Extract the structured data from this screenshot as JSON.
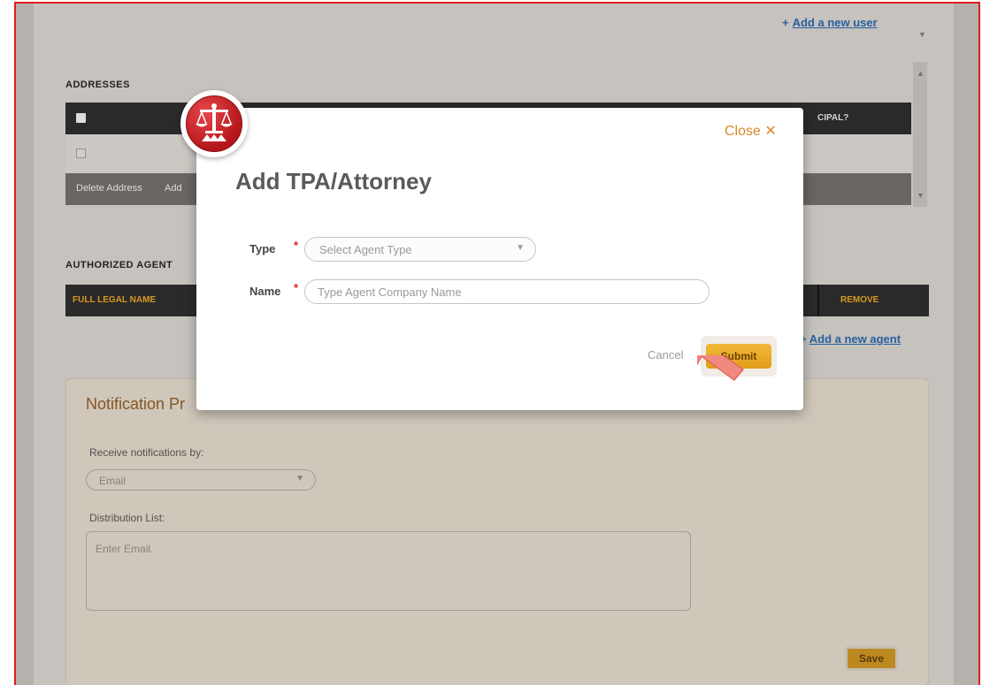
{
  "header": {
    "add_user_plus": "+",
    "add_user_label": "Add a new user"
  },
  "addresses": {
    "title": "ADDRESSES",
    "principal_header": "CIPAL?",
    "actions": [
      "Delete Address",
      "Add"
    ]
  },
  "agents": {
    "title": "AUTHORIZED AGENT",
    "col_full_legal_name": "FULL LEGAL NAME",
    "col_remove": "REMOVE",
    "add_agent_plus": "+",
    "add_agent_label": "Add a new agent"
  },
  "notification": {
    "title": "Notification Pr",
    "receive_label": "Receive notifications by:",
    "receive_value": "Email",
    "distribution_label": "Distribution List:",
    "distribution_placeholder": "Enter Email.",
    "save_label": "Save"
  },
  "modal": {
    "close_label": "Close ✕",
    "title": "Add TPA/Attorney",
    "type_label": "Type",
    "type_placeholder": "Select Agent Type",
    "name_label": "Name",
    "name_placeholder": "Type Agent Company Name",
    "required_mark": "*",
    "cancel_label": "Cancel",
    "submit_label": "Submit",
    "logo_icon": "scales-of-justice-icon"
  },
  "colors": {
    "accent_orange": "#d98a2a",
    "submit_yellow": "#e9a82a",
    "link_blue": "#2a64a8",
    "table_dark": "#2b2b2b",
    "frame_red": "#e01e1e"
  }
}
